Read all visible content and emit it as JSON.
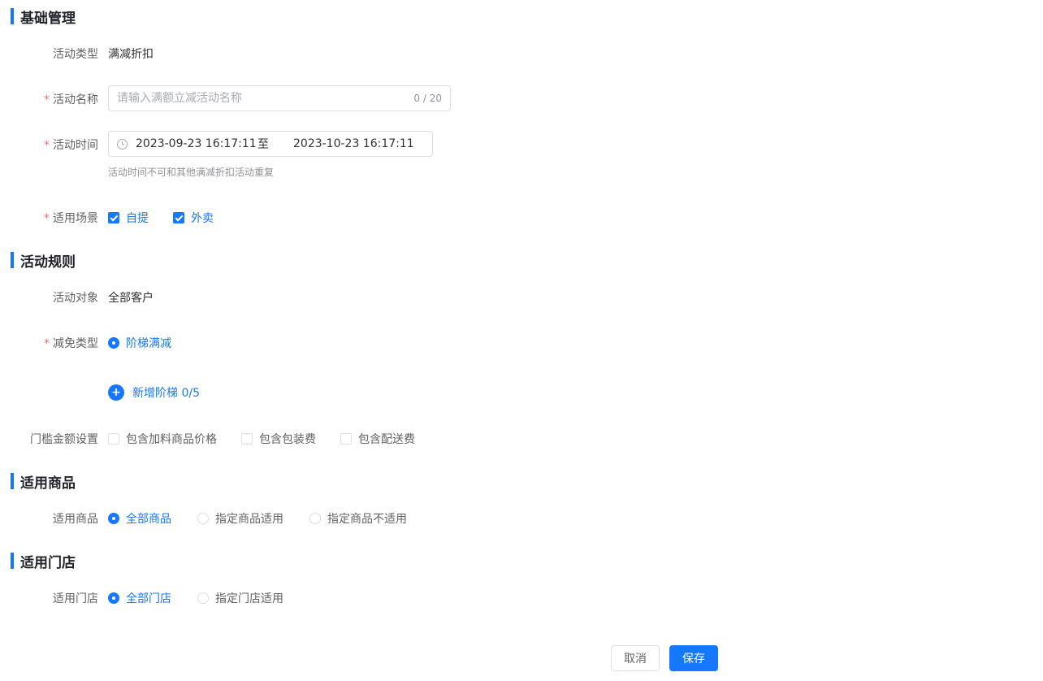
{
  "basic": {
    "title": "基础管理",
    "activity_type": {
      "label": "活动类型",
      "value": "满减折扣"
    },
    "activity_name": {
      "label": "活动名称",
      "placeholder": "请输入满额立减活动名称",
      "value": "",
      "count": "0 / 20"
    },
    "activity_time": {
      "label": "活动时间",
      "start": "2023-09-23 16:17:11",
      "separator": "至",
      "end": "2023-10-23 16:17:11",
      "hint": "活动时间不可和其他满减折扣活动重复"
    },
    "scene": {
      "label": "适用场景",
      "options": [
        {
          "label": "自提",
          "checked": true
        },
        {
          "label": "外卖",
          "checked": true
        }
      ]
    }
  },
  "rules": {
    "title": "活动规则",
    "target": {
      "label": "活动对象",
      "value": "全部客户"
    },
    "reduce_type": {
      "label": "减免类型",
      "options": [
        {
          "label": "阶梯满减",
          "selected": true
        }
      ]
    },
    "add_tier": {
      "label": "新增阶梯 0/5"
    },
    "threshold": {
      "label": "门槛金额设置",
      "options": [
        {
          "label": "包含加料商品价格",
          "checked": false
        },
        {
          "label": "包含包装费",
          "checked": false
        },
        {
          "label": "包含配送费",
          "checked": false
        }
      ]
    }
  },
  "goods": {
    "title": "适用商品",
    "field": {
      "label": "适用商品",
      "options": [
        {
          "label": "全部商品",
          "selected": true
        },
        {
          "label": "指定商品适用",
          "selected": false
        },
        {
          "label": "指定商品不适用",
          "selected": false
        }
      ]
    }
  },
  "stores": {
    "title": "适用门店",
    "field": {
      "label": "适用门店",
      "options": [
        {
          "label": "全部门店",
          "selected": true
        },
        {
          "label": "指定门店适用",
          "selected": false
        }
      ]
    }
  },
  "actions": {
    "cancel": "取消",
    "save": "保存"
  },
  "required_mark": "*",
  "colors": {
    "primary": "#1677ff",
    "required": "#f56c6c"
  },
  "icons": {
    "time": "clock-icon",
    "add": "plus-icon",
    "checked": "check-icon"
  }
}
